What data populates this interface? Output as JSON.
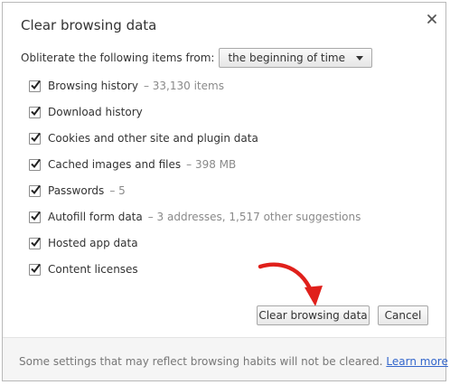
{
  "dialog": {
    "title": "Clear browsing data",
    "close_glyph": "×",
    "from_label": "Obliterate the following items from:",
    "time_range": {
      "selected": "the beginning of time"
    }
  },
  "options": [
    {
      "label": "Browsing history",
      "detail": "– 33,130 items",
      "checked": true
    },
    {
      "label": "Download history",
      "detail": "",
      "checked": true
    },
    {
      "label": "Cookies and other site and plugin data",
      "detail": "",
      "checked": true
    },
    {
      "label": "Cached images and files",
      "detail": "– 398 MB",
      "checked": true
    },
    {
      "label": "Passwords",
      "detail": "– 5",
      "checked": true
    },
    {
      "label": "Autofill form data",
      "detail": "– 3 addresses, 1,517 other suggestions",
      "checked": true
    },
    {
      "label": "Hosted app data",
      "detail": "",
      "checked": true
    },
    {
      "label": "Content licenses",
      "detail": "",
      "checked": true
    }
  ],
  "buttons": {
    "clear": "Clear browsing data",
    "cancel": "Cancel"
  },
  "footer": {
    "text": "Some settings that may reflect browsing habits will not be cleared.",
    "link": "Learn more"
  },
  "colors": {
    "annotation_arrow": "#e0201b",
    "link": "#3366cc",
    "footer_bg": "#f5f5f5"
  },
  "icons": {
    "close": "close-icon",
    "dropdown": "chevron-down-icon",
    "checkbox": "checkmark-icon",
    "annotation": "curved-arrow-icon"
  }
}
